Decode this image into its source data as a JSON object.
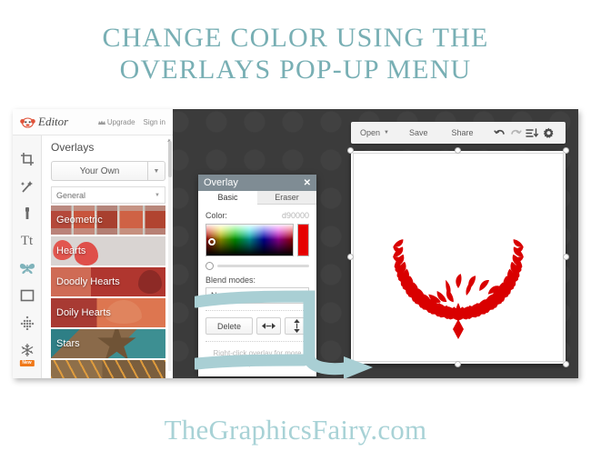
{
  "title": {
    "line1": "Change Color Using the",
    "line2": "Overlays Pop-Up Menu"
  },
  "watermark": "TheGraphicsFairy.com",
  "colors": {
    "title_teal": "#78afb4",
    "watermark_teal": "#a8d2d6",
    "annotation_teal": "#a9cfd4",
    "editor_bg": "#3b3b3b",
    "dialog_titlebar": "#7f8c94",
    "overlay_red": "#d90000",
    "new_badge_orange": "#f07818"
  },
  "editor": {
    "header": {
      "logo_icon": "picmonkey-monkey-icon",
      "logo_word": "Editor",
      "upgrade_icon": "crown-icon",
      "upgrade": "Upgrade",
      "signin": "Sign in"
    },
    "tool_rail": [
      {
        "name": "crop-icon",
        "label": "Crop",
        "active": false
      },
      {
        "name": "magic-wand-icon",
        "label": "Effects",
        "active": false
      },
      {
        "name": "touch-up-icon",
        "label": "Touch Up",
        "active": false
      },
      {
        "name": "text-icon",
        "label": "Tt",
        "active": false
      },
      {
        "name": "butterfly-icon",
        "label": "Overlays",
        "active": true
      },
      {
        "name": "frame-icon",
        "label": "Frames",
        "active": false
      },
      {
        "name": "texture-icon",
        "label": "Textures",
        "active": false
      },
      {
        "name": "snowflake-icon",
        "label": "Themes",
        "active": false,
        "badge": "New"
      }
    ],
    "overlays_panel": {
      "title": "Overlays",
      "your_own_button": "Your Own",
      "your_own_caret_icon": "chevron-down-icon",
      "category_select": "General",
      "category_caret_icon": "chevron-down-icon",
      "items": [
        {
          "label": "Geometric",
          "thumb_class": "t-geometric"
        },
        {
          "label": "Hearts",
          "thumb_class": "t-hearts"
        },
        {
          "label": "Doodly Hearts",
          "thumb_class": "t-doodly"
        },
        {
          "label": "Doily Hearts",
          "thumb_class": "t-doily"
        },
        {
          "label": "Stars",
          "thumb_class": "t-stars"
        },
        {
          "label": "",
          "thumb_class": "t-scribble"
        }
      ]
    },
    "toolbar": {
      "open": "Open",
      "open_caret_icon": "chevron-down-icon",
      "save": "Save",
      "share": "Share",
      "undo_icon": "undo-arrow-icon",
      "redo_icon": "redo-arrow-icon",
      "export_icon": "export-download-icon",
      "settings_icon": "gear-icon"
    },
    "canvas": {
      "artwork": "red-laurel-wreath",
      "artwork_color": "#d90000",
      "selection_handles": 8
    }
  },
  "overlay_dialog": {
    "title": "Overlay",
    "close_icon": "close-x-icon",
    "tabs": [
      {
        "label": "Basic",
        "active": true
      },
      {
        "label": "Eraser",
        "active": false
      }
    ],
    "color_label": "Color:",
    "color_value": "d90000",
    "saturation_picker_icon": "saturation-value-picker",
    "hue_bar_icon": "hue-slider",
    "fade_slider_icon": "fade-slider",
    "blend_label": "Blend modes:",
    "blend_value": "Normal",
    "blend_caret_icon": "chevron-down-icon",
    "delete_button": "Delete",
    "flip_horizontal_icon": "flip-horizontal-icon",
    "flip_vertical_icon": "flip-vertical-icon",
    "hint": "Right-click overlay for more options."
  },
  "annotation": {
    "type": "teal-curved-arrow",
    "description": "Teal arrow from color picker to wreath"
  }
}
